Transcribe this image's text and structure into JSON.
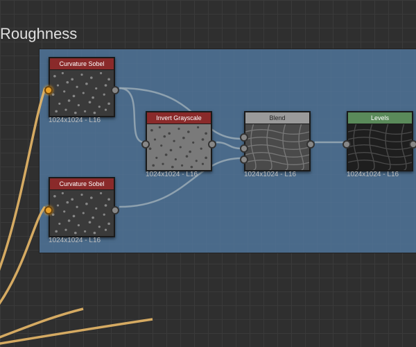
{
  "group": {
    "label": "Roughness"
  },
  "nodes": {
    "curvature1": {
      "title": "Curvature Sobel",
      "meta": "1024x1024 - L16"
    },
    "curvature2": {
      "title": "Curvature Sobel",
      "meta": "1024x1024 - L16"
    },
    "invert": {
      "title": "Invert Grayscale",
      "meta": "1024x1024 - L16"
    },
    "blend": {
      "title": "Blend",
      "meta": "1024x1024 - L16"
    },
    "levels": {
      "title": "Levels",
      "meta": "1024x1024 - L16"
    }
  }
}
